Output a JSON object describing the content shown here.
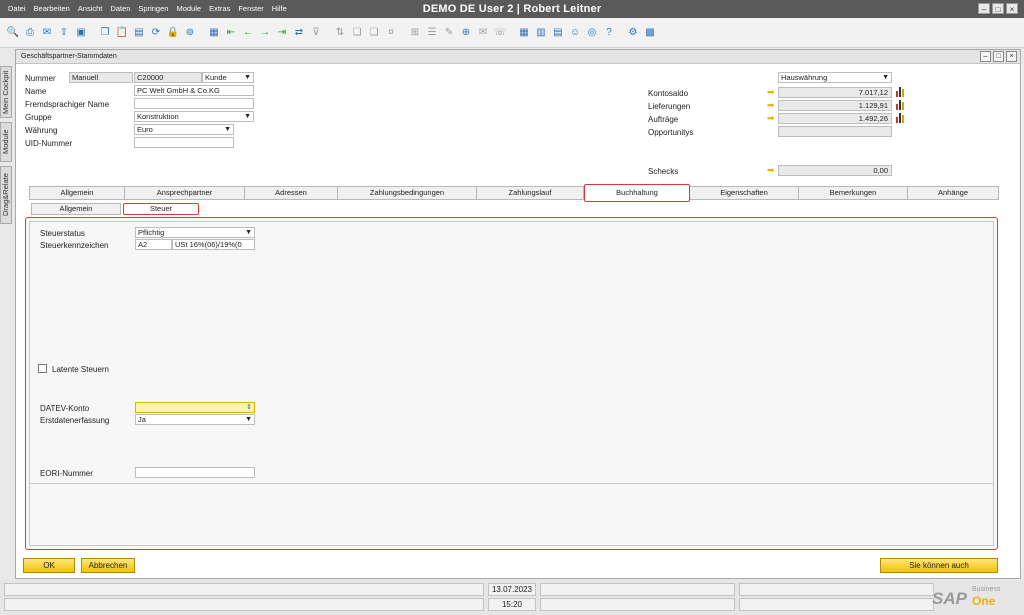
{
  "app": {
    "title": "DEMO DE User 2 | Robert Leitner",
    "menu": [
      "Datei",
      "Bearbeiten",
      "Ansicht",
      "Daten",
      "Springen",
      "Module",
      "Extras",
      "Fenster",
      "Hilfe"
    ],
    "window_controls": [
      "–",
      "□",
      "×"
    ]
  },
  "toolbar": {
    "icons": [
      "preview-icon",
      "print-icon",
      "email-icon",
      "export-icon",
      "save-icon",
      "copy-icon",
      "paste-icon",
      "document-icon",
      "refresh-icon",
      "lock-icon",
      "binoculars-icon",
      "report-icon",
      "first-record-icon",
      "previous-record-icon",
      "next-record-icon",
      "last-record-icon",
      "sync-icon",
      "filter-icon",
      "sort-icon",
      "base-document-icon",
      "target-document-icon",
      "cash-icon",
      "payment-icon",
      "journal-icon",
      "document-edit-icon",
      "add-icon",
      "message-icon",
      "chat-icon",
      "grid-icon",
      "pdf-icon",
      "calculator-icon",
      "users-icon",
      "browser-icon",
      "help-icon",
      "settings-icon",
      "tiles-icon"
    ]
  },
  "sidetabs": [
    "Mein Cockpit",
    "Module",
    "Drag&Relate"
  ],
  "form": {
    "title": "Geschäftspartner-Stammdaten",
    "controls": [
      "–",
      "□",
      "×"
    ],
    "header": {
      "nummer_label": "Nummer",
      "nummer_series": "Manuell",
      "nummer_value": "C20000",
      "type_value": "Kunde",
      "name_label": "Name",
      "name_value": "PC Welt GmbH & Co.KG",
      "fremd_label": "Fremdsprachiger Name",
      "fremd_value": "",
      "gruppe_label": "Gruppe",
      "gruppe_value": "Konstruktion",
      "waehrung_label": "Währung",
      "waehrung_value": "Euro",
      "uid_label": "UID-Nummer",
      "uid_value": ""
    },
    "balances": {
      "currency_value": "Hauswährung",
      "kontosaldo_label": "Kontosaldo",
      "kontosaldo_value": "7.017,12",
      "lieferungen_label": "Lieferungen",
      "lieferungen_value": "1.129,91",
      "auftraege_label": "Aufträge",
      "auftraege_value": "1.492,26",
      "opportunitys_label": "Opportunitys",
      "opportunitys_value": "",
      "schecks_label": "Schecks",
      "schecks_value": "0,00"
    },
    "tabs": [
      "Allgemein",
      "Ansprechpartner",
      "Adressen",
      "Zahlungsbedingungen",
      "Zahlungslauf",
      "Buchhaltung",
      "Eigenschaften",
      "Bemerkungen",
      "Anhänge"
    ],
    "active_tab": "Buchhaltung",
    "subtabs": [
      "Allgemein",
      "Steuer"
    ],
    "active_subtab": "Steuer",
    "steuer": {
      "steuerstatus_label": "Steuerstatus",
      "steuerstatus_value": "Pflichtig",
      "steuerkennzeichen_label": "Steuerkennzeichen",
      "steuerkennzeichen_code": "A2",
      "steuerkennzeichen_desc": "USt 16%(06)/19%(0",
      "latente_label": "Latente Steuern",
      "latente_checked": false,
      "datev_label": "DATEV-Konto",
      "datev_value": "",
      "erstdaten_label": "Erstdatenerfassung",
      "erstdaten_value": "Ja",
      "eori_label": "EORI-Nummer",
      "eori_value": ""
    },
    "buttons": {
      "ok": "OK",
      "cancel": "Abbrechen",
      "relate": "Sie können auch"
    }
  },
  "statusbar": {
    "date": "13.07.2023",
    "time": "15:20",
    "logo_main": "SAP",
    "logo_sub1": "Business",
    "logo_sub2": "One"
  },
  "colors": {
    "highlight_red": "#d83a3a",
    "button_yellow": "#f2c400",
    "field_yellow": "#fff2b0",
    "titlebar": "#5a5a5a"
  }
}
